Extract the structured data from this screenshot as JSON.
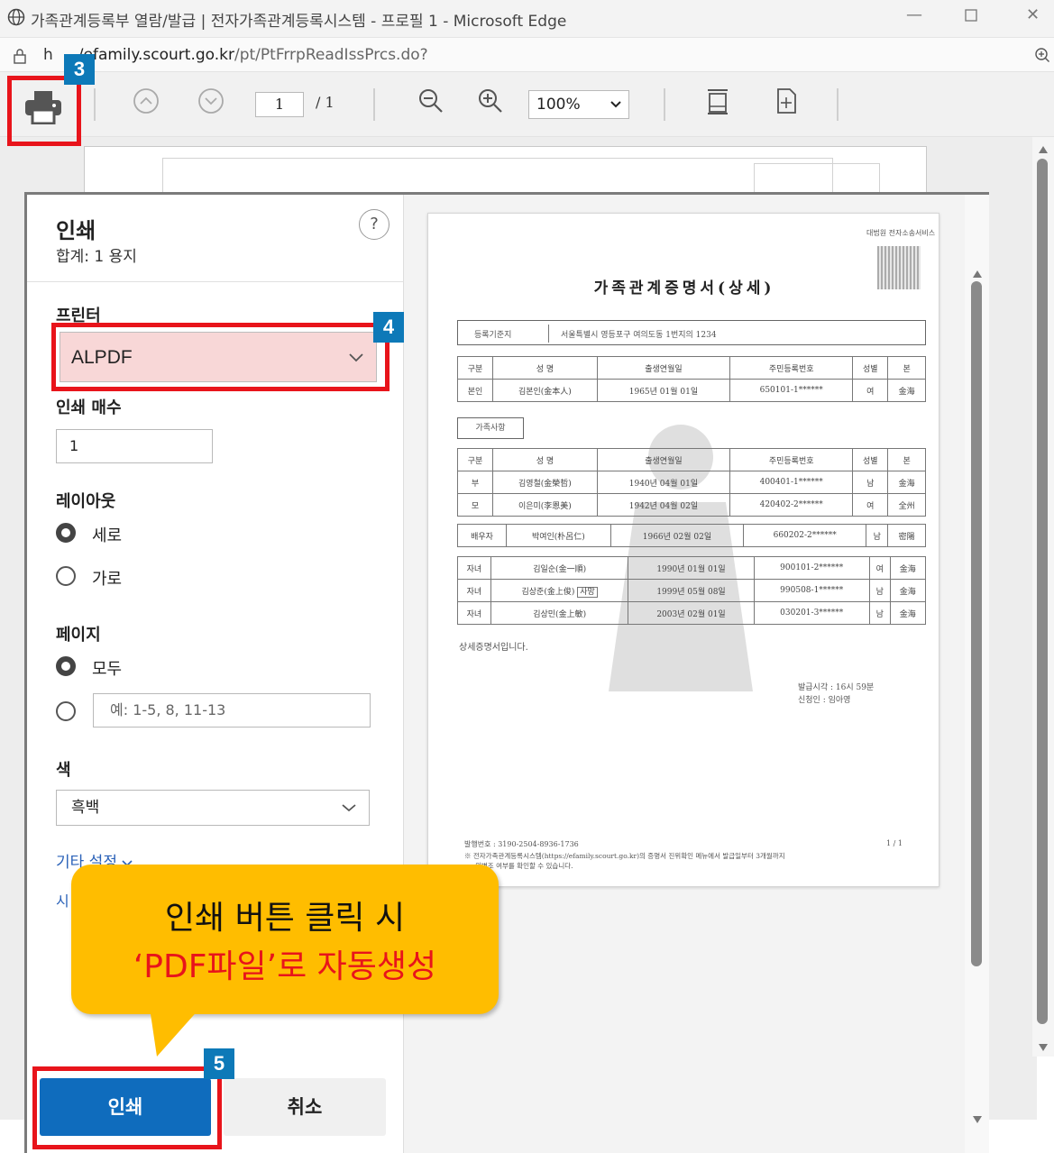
{
  "window": {
    "title": "가족관계등록부 열람/발급 | 전자가족관계등록시스템 - 프로필 1 - Microsoft Edge",
    "url_prefix": "h",
    "url_domain": "/efamily.scourt.go.kr",
    "url_path": "/pt/PtFrrpReadIssPrcs.do?"
  },
  "pdf_toolbar": {
    "page_current": "1",
    "page_total": "/ 1",
    "zoom": "100%"
  },
  "print_dialog": {
    "title": "인쇄",
    "total": "합계: 1 용지",
    "help": "?",
    "printer_label": "프린터",
    "printer_value": "ALPDF",
    "copies_label": "인쇄 매수",
    "copies_value": "1",
    "layout_label": "레이아웃",
    "layout_options": [
      "세로",
      "가로"
    ],
    "layout_selected": "세로",
    "pages_label": "페이지",
    "pages_all": "모두",
    "pages_range_placeholder": "예: 1-5, 8, 11-13",
    "color_label": "색",
    "color_value": "흑백",
    "more_settings": "기타 설정",
    "partial_label": "시",
    "print_button": "인쇄",
    "cancel_button": "취소"
  },
  "preview": {
    "logo_text": "대법원 전자소송서비스",
    "doc_title": "가족관계증명서(상세)",
    "registry_label": "등록기준지",
    "registry_value": "서울특별시 영등포구 여의도동 1번지의 1234",
    "headers": [
      "구분",
      "성 명",
      "출생연월일",
      "주민등록번호",
      "성별",
      "본"
    ],
    "self_row": [
      "본인",
      "김본인(金本人)",
      "1965년 01월 01일",
      "650101-1******",
      "여",
      "金海"
    ],
    "family_label": "가족사항",
    "parents": [
      [
        "부",
        "김영철(金榮哲)",
        "1940년 04월 01일",
        "400401-1******",
        "남",
        "金海"
      ],
      [
        "모",
        "이은미(李恩美)",
        "1942년 04월 02일",
        "420402-2******",
        "여",
        "全州"
      ]
    ],
    "spouse": [
      "배우자",
      "박여인(朴呂仁)",
      "1966년 02월 02일",
      "660202-2******",
      "남",
      "密陽"
    ],
    "children": [
      [
        "자녀",
        "김일순(金一順)",
        "1990년 01월 01일",
        "900101-2******",
        "여",
        "金海"
      ],
      [
        "자녀",
        "김상준(金上俊)",
        "1999년 05월 08일",
        "990508-1******",
        "남",
        "金海"
      ],
      [
        "자녀",
        "김상민(金上敏)",
        "2003년 02월 01일",
        "030201-3******",
        "남",
        "金海"
      ]
    ],
    "deceased_tag": "사망",
    "statement": "상세증명서입니다.",
    "issue_time": "발급시각 : 16시 59분",
    "applicant": "신청인 : 임아영",
    "issue_no": "발행번호 : 3190-2504-8936-1736",
    "page_no": "1  /  1",
    "footnote1": "※ 전자가족관계등록시스템(https://efamily.scourt.go.kr)의 증명서 진위확인 메뉴에서 발급일부터 3개월까지",
    "footnote2": "위변조 여부를 확인할 수 있습니다."
  },
  "annotations": {
    "badge_3": "3",
    "badge_4": "4",
    "badge_5": "5",
    "callout_line1": "인쇄 버튼 클릭 시",
    "callout_line2": "‘PDF파일’로 자동생성"
  },
  "colors": {
    "highlight_red": "#e8141b",
    "badge_blue": "#0d79b8",
    "callout_yellow": "#ffbd00",
    "print_blue": "#0f6cbd"
  }
}
